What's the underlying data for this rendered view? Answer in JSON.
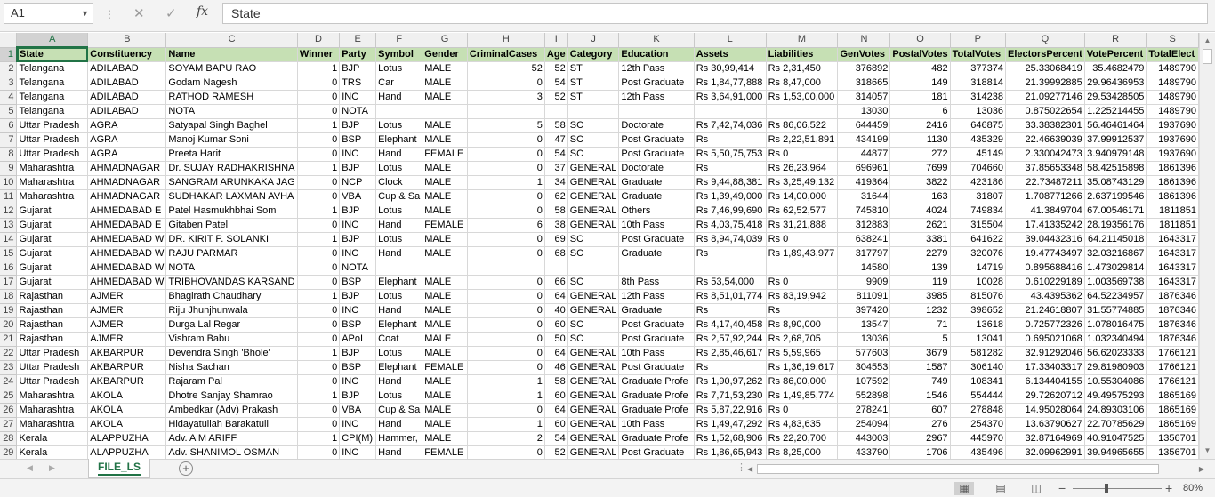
{
  "formula_bar": {
    "name_box": "A1",
    "formula": "State"
  },
  "columns": [
    "A",
    "B",
    "C",
    "D",
    "E",
    "F",
    "G",
    "H",
    "I",
    "J",
    "K",
    "L",
    "M",
    "N",
    "O",
    "P",
    "Q",
    "R",
    "S"
  ],
  "header": [
    "State",
    "Constituency",
    "Name",
    "Winner",
    "Party",
    "Symbol",
    "Gender",
    "CriminalCases",
    "Age",
    "Category",
    "Education",
    "Assets",
    "Liabilities",
    "GenVotes",
    "PostalVotes",
    "TotalVotes",
    "ElectorsPercent",
    "VotePercent",
    "TotalElect"
  ],
  "rows": [
    [
      "Telangana",
      "ADILABAD",
      "SOYAM BAPU RAO",
      "1",
      "BJP",
      "Lotus",
      "MALE",
      "52",
      "52",
      "ST",
      "12th Pass",
      "Rs 30,99,414",
      "Rs 2,31,450",
      "376892",
      "482",
      "377374",
      "25.33068419",
      "35.4682479",
      "1489790"
    ],
    [
      "Telangana",
      "ADILABAD",
      "Godam Nagesh",
      "0",
      "TRS",
      "Car",
      "MALE",
      "0",
      "54",
      "ST",
      "Post Graduate",
      "Rs 1,84,77,888",
      "Rs 8,47,000",
      "318665",
      "149",
      "318814",
      "21.39992885",
      "29.96436953",
      "1489790"
    ],
    [
      "Telangana",
      "ADILABAD",
      "RATHOD RAMESH",
      "0",
      "INC",
      "Hand",
      "MALE",
      "3",
      "52",
      "ST",
      "12th Pass",
      "Rs 3,64,91,000",
      "Rs 1,53,00,000",
      "314057",
      "181",
      "314238",
      "21.09277146",
      "29.53428505",
      "1489790"
    ],
    [
      "Telangana",
      "ADILABAD",
      "NOTA",
      "0",
      "NOTA",
      "",
      "",
      "",
      "",
      "",
      "",
      "",
      "",
      "13030",
      "6",
      "13036",
      "0.875022654",
      "1.225214455",
      "1489790"
    ],
    [
      "Uttar Pradesh",
      "AGRA",
      "Satyapal Singh Baghel",
      "1",
      "BJP",
      "Lotus",
      "MALE",
      "5",
      "58",
      "SC",
      "Doctorate",
      "Rs 7,42,74,036",
      "Rs 86,06,522",
      "644459",
      "2416",
      "646875",
      "33.38382301",
      "56.46461464",
      "1937690"
    ],
    [
      "Uttar Pradesh",
      "AGRA",
      "Manoj Kumar Soni",
      "0",
      "BSP",
      "Elephant",
      "MALE",
      "0",
      "47",
      "SC",
      "Post Graduate",
      "Rs",
      "Rs 2,22,51,891",
      "434199",
      "1130",
      "435329",
      "22.46639039",
      "37.99912537",
      "1937690"
    ],
    [
      "Uttar Pradesh",
      "AGRA",
      "Preeta Harit",
      "0",
      "INC",
      "Hand",
      "FEMALE",
      "0",
      "54",
      "SC",
      "Post Graduate",
      "Rs 5,50,75,753",
      "Rs 0",
      "44877",
      "272",
      "45149",
      "2.330042473",
      "3.940979148",
      "1937690"
    ],
    [
      "Maharashtra",
      "AHMADNAGAR",
      "Dr. SUJAY RADHAKRISHNA",
      "1",
      "BJP",
      "Lotus",
      "MALE",
      "0",
      "37",
      "GENERAL",
      "Doctorate",
      "Rs",
      "Rs 26,23,964",
      "696961",
      "7699",
      "704660",
      "37.85653348",
      "58.42515898",
      "1861396"
    ],
    [
      "Maharashtra",
      "AHMADNAGAR",
      "SANGRAM ARUNKAKA JAG",
      "0",
      "NCP",
      "Clock",
      "MALE",
      "1",
      "34",
      "GENERAL",
      "Graduate",
      "Rs 9,44,88,381",
      "Rs 3,25,49,132",
      "419364",
      "3822",
      "423186",
      "22.73487211",
      "35.08743129",
      "1861396"
    ],
    [
      "Maharashtra",
      "AHMADNAGAR",
      "SUDHAKAR LAXMAN AVHA",
      "0",
      "VBA",
      "Cup & Sa",
      "MALE",
      "0",
      "62",
      "GENERAL",
      "Graduate",
      "Rs 1,39,49,000",
      "Rs 14,00,000",
      "31644",
      "163",
      "31807",
      "1.708771266",
      "2.637199546",
      "1861396"
    ],
    [
      "Gujarat",
      "AHMEDABAD E",
      "Patel Hasmukhbhai Som",
      "1",
      "BJP",
      "Lotus",
      "MALE",
      "0",
      "58",
      "GENERAL",
      "Others",
      "Rs 7,46,99,690",
      "Rs 62,52,577",
      "745810",
      "4024",
      "749834",
      "41.3849704",
      "67.00546171",
      "1811851"
    ],
    [
      "Gujarat",
      "AHMEDABAD E",
      "Gitaben Patel",
      "0",
      "INC",
      "Hand",
      "FEMALE",
      "6",
      "38",
      "GENERAL",
      "10th Pass",
      "Rs 4,03,75,418",
      "Rs 31,21,888",
      "312883",
      "2621",
      "315504",
      "17.41335242",
      "28.19356176",
      "1811851"
    ],
    [
      "Gujarat",
      "AHMEDABAD W",
      "DR. KIRIT P. SOLANKI",
      "1",
      "BJP",
      "Lotus",
      "MALE",
      "0",
      "69",
      "SC",
      "Post Graduate",
      "Rs 8,94,74,039",
      "Rs 0",
      "638241",
      "3381",
      "641622",
      "39.04432316",
      "64.21145018",
      "1643317"
    ],
    [
      "Gujarat",
      "AHMEDABAD W",
      "RAJU PARMAR",
      "0",
      "INC",
      "Hand",
      "MALE",
      "0",
      "68",
      "SC",
      "Graduate",
      "Rs",
      "Rs 1,89,43,977",
      "317797",
      "2279",
      "320076",
      "19.47743497",
      "32.03216867",
      "1643317"
    ],
    [
      "Gujarat",
      "AHMEDABAD W",
      "NOTA",
      "0",
      "NOTA",
      "",
      "",
      "",
      "",
      "",
      "",
      "",
      "",
      "14580",
      "139",
      "14719",
      "0.895688416",
      "1.473029814",
      "1643317"
    ],
    [
      "Gujarat",
      "AHMEDABAD W",
      "TRIBHOVANDAS KARSAND",
      "0",
      "BSP",
      "Elephant",
      "MALE",
      "0",
      "66",
      "SC",
      "8th Pass",
      "Rs 53,54,000",
      "Rs 0",
      "9909",
      "119",
      "10028",
      "0.610229189",
      "1.003569738",
      "1643317"
    ],
    [
      "Rajasthan",
      "AJMER",
      "Bhagirath Chaudhary",
      "1",
      "BJP",
      "Lotus",
      "MALE",
      "0",
      "64",
      "GENERAL",
      "12th Pass",
      "Rs 8,51,01,774",
      "Rs 83,19,942",
      "811091",
      "3985",
      "815076",
      "43.4395362",
      "64.52234957",
      "1876346"
    ],
    [
      "Rajasthan",
      "AJMER",
      "Riju Jhunjhunwala",
      "0",
      "INC",
      "Hand",
      "MALE",
      "0",
      "40",
      "GENERAL",
      "Graduate",
      "Rs",
      "Rs",
      "397420",
      "1232",
      "398652",
      "21.24618807",
      "31.55774885",
      "1876346"
    ],
    [
      "Rajasthan",
      "AJMER",
      "Durga Lal Regar",
      "0",
      "BSP",
      "Elephant",
      "MALE",
      "0",
      "60",
      "SC",
      "Post Graduate",
      "Rs 4,17,40,458",
      "Rs 8,90,000",
      "13547",
      "71",
      "13618",
      "0.725772326",
      "1.078016475",
      "1876346"
    ],
    [
      "Rajasthan",
      "AJMER",
      "Vishram Babu",
      "0",
      "APoI",
      "Coat",
      "MALE",
      "0",
      "50",
      "SC",
      "Post Graduate",
      "Rs 2,57,92,244",
      "Rs 2,68,705",
      "13036",
      "5",
      "13041",
      "0.695021068",
      "1.032340494",
      "1876346"
    ],
    [
      "Uttar Pradesh",
      "AKBARPUR",
      "Devendra Singh 'Bhole'",
      "1",
      "BJP",
      "Lotus",
      "MALE",
      "0",
      "64",
      "GENERAL",
      "10th Pass",
      "Rs 2,85,46,617",
      "Rs 5,59,965",
      "577603",
      "3679",
      "581282",
      "32.91292046",
      "56.62023333",
      "1766121"
    ],
    [
      "Uttar Pradesh",
      "AKBARPUR",
      "Nisha Sachan",
      "0",
      "BSP",
      "Elephant",
      "FEMALE",
      "0",
      "46",
      "GENERAL",
      "Post Graduate",
      "Rs",
      "Rs 1,36,19,617",
      "304553",
      "1587",
      "306140",
      "17.33403317",
      "29.81980903",
      "1766121"
    ],
    [
      "Uttar Pradesh",
      "AKBARPUR",
      "Rajaram Pal",
      "0",
      "INC",
      "Hand",
      "MALE",
      "1",
      "58",
      "GENERAL",
      "Graduate Profe",
      "Rs 1,90,97,262",
      "Rs 86,00,000",
      "107592",
      "749",
      "108341",
      "6.134404155",
      "10.55304086",
      "1766121"
    ],
    [
      "Maharashtra",
      "AKOLA",
      "Dhotre Sanjay Shamrao",
      "1",
      "BJP",
      "Lotus",
      "MALE",
      "1",
      "60",
      "GENERAL",
      "Graduate Profe",
      "Rs 7,71,53,230",
      "Rs 1,49,85,774",
      "552898",
      "1546",
      "554444",
      "29.72620712",
      "49.49575293",
      "1865169"
    ],
    [
      "Maharashtra",
      "AKOLA",
      "Ambedkar (Adv) Prakash",
      "0",
      "VBA",
      "Cup & Sa",
      "MALE",
      "0",
      "64",
      "GENERAL",
      "Graduate Profe",
      "Rs 5,87,22,916",
      "Rs 0",
      "278241",
      "607",
      "278848",
      "14.95028064",
      "24.89303106",
      "1865169"
    ],
    [
      "Maharashtra",
      "AKOLA",
      "Hidayatullah Barakatull",
      "0",
      "INC",
      "Hand",
      "MALE",
      "1",
      "60",
      "GENERAL",
      "10th Pass",
      "Rs 1,49,47,292",
      "Rs 4,83,635",
      "254094",
      "276",
      "254370",
      "13.63790627",
      "22.70785629",
      "1865169"
    ],
    [
      "Kerala",
      "ALAPPUZHA",
      "Adv. A M ARIFF",
      "1",
      "CPI(M)",
      "Hammer,",
      "MALE",
      "2",
      "54",
      "GENERAL",
      "Graduate Profe",
      "Rs 1,52,68,906",
      "Rs 22,20,700",
      "443003",
      "2967",
      "445970",
      "32.87164969",
      "40.91047525",
      "1356701"
    ],
    [
      "Kerala",
      "ALAPPUZHA",
      "Adv. SHANIMOL OSMAN",
      "0",
      "INC",
      "Hand",
      "FEMALE",
      "0",
      "52",
      "GENERAL",
      "Post Graduate",
      "Rs 1,86,65,943",
      "Rs 8,25,000",
      "433790",
      "1706",
      "435496",
      "32.09962991",
      "39.94965655",
      "1356701"
    ]
  ],
  "sheet_tab": "FILE_LS",
  "status": {
    "zoom": "80%"
  },
  "icons": {
    "name_box_dropdown": "chevron-down-icon",
    "cancel": "close-icon",
    "enter": "check-icon",
    "function": "fx-icon",
    "add_sheet": "plus-circle-icon"
  },
  "colors": {
    "accent": "#217346",
    "header_fill": "#c6e0b4"
  }
}
